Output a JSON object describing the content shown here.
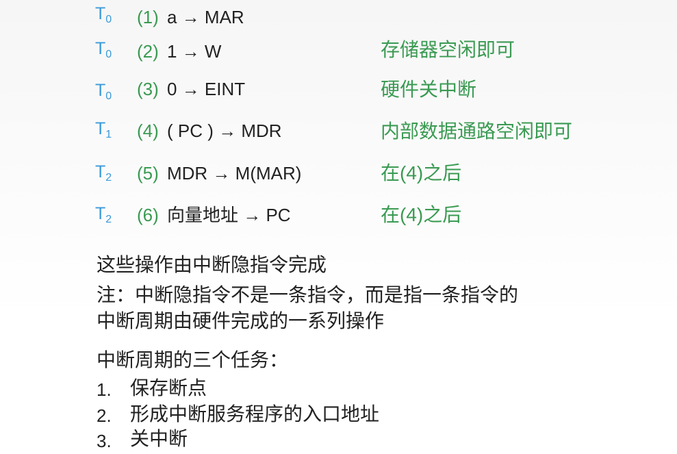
{
  "steps": [
    {
      "t": "T",
      "sub": "0",
      "num": "(1)",
      "op": "a → MAR",
      "note": ""
    },
    {
      "t": "T",
      "sub": "0",
      "num": "(2)",
      "op": "1 → W",
      "note": "存储器空闲即可"
    },
    {
      "t": "T",
      "sub": "0",
      "num": "(3)",
      "op": "0 → EINT",
      "note": "硬件关中断"
    },
    {
      "t": "T",
      "sub": "1",
      "num": "(4)",
      "op": "( PC ) → MDR",
      "note": "内部数据通路空闲即可"
    },
    {
      "t": "T",
      "sub": "2",
      "num": "(5)",
      "op": "MDR → M(MAR)",
      "note": "在(4)之后"
    },
    {
      "t": "T",
      "sub": "2",
      "num": "(6)",
      "op": "向量地址 → PC",
      "note": "在(4)之后"
    }
  ],
  "explanation": {
    "line1": "这些操作由中断隐指令完成",
    "line2": "注：中断隐指令不是一条指令，而是指一条指令的",
    "line3": "中断周期由硬件完成的一系列操作"
  },
  "tasks": {
    "title": "中断周期的三个任务：",
    "items": [
      {
        "num": "1.",
        "text": "保存断点"
      },
      {
        "num": "2.",
        "text": "形成中断服务程序的入口地址"
      },
      {
        "num": "3.",
        "text": "关中断"
      }
    ]
  },
  "colors": {
    "t_label": "#3a9ad9",
    "step_number": "#3a9a52",
    "note": "#3a9a52",
    "text": "#222222"
  }
}
